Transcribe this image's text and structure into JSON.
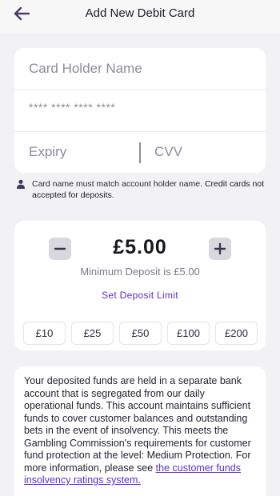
{
  "header": {
    "title": "Add New Debit Card"
  },
  "form": {
    "card_holder_placeholder": "Card Holder Name",
    "card_number_placeholder": "**** **** **** ****",
    "expiry_placeholder": "Expiry",
    "cvv_placeholder": "CVV"
  },
  "note": {
    "text": "Card name must match account holder name. ",
    "strong": "Credit cards not accepted for deposits."
  },
  "deposit": {
    "amount": "£5.00",
    "minimum_text": "Minimum Deposit is £5.00",
    "limit_link": "Set Deposit Limit",
    "quick_amounts": [
      "£10",
      "£25",
      "£50",
      "£100",
      "£200"
    ]
  },
  "info": {
    "text": "Your deposited funds are held in a separate bank account that is segregated from our daily operational funds. This account maintains sufficient funds to cover customer balances and outstanding bets in the event of insolvency. This meets the Gambling Commission's requirements for customer fund protection at the level: Medium Protection. For more information, please see ",
    "link": "the customer funds insolvency ratings system."
  },
  "colors": {
    "accent": "#5a31c9",
    "background": "#f2f1f4",
    "card": "#ffffff",
    "stepper": "#dad8df"
  },
  "icons": {
    "back": "arrow-left-icon",
    "person": "person-icon",
    "minus": "minus-icon",
    "plus": "plus-icon"
  }
}
